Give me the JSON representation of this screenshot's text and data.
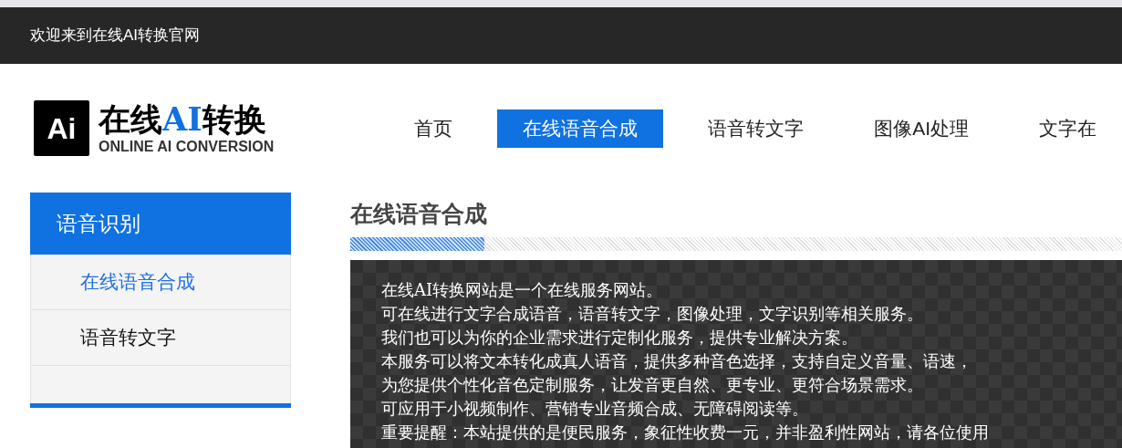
{
  "top_bar": {
    "welcome": "欢迎来到在线AI转换官网"
  },
  "logo": {
    "mark": "Ai",
    "title_segments": [
      {
        "text": "在线",
        "highlight": false
      },
      {
        "text": "AI",
        "highlight": true
      },
      {
        "text": "转换",
        "highlight": false
      }
    ],
    "subtitle": "ONLINE AI CONVERSION"
  },
  "nav": [
    {
      "label": "首页",
      "selected": false
    },
    {
      "label": "在线语音合成",
      "selected": true
    },
    {
      "label": "语音转文字",
      "selected": false
    },
    {
      "label": "图像AI处理",
      "selected": false
    },
    {
      "label": "文字在",
      "selected": false
    }
  ],
  "sidebar": {
    "title": "语音识别",
    "items": [
      {
        "label": "在线语音合成",
        "selected": true
      },
      {
        "label": "语音转文字",
        "selected": false
      }
    ]
  },
  "content": {
    "title": "在线语音合成",
    "lines": [
      "在线AI转换网站是一个在线服务网站。",
      "可在线进行文字合成语音，语音转文字，图像处理，文字识别等相关服务。",
      "我们也可以为你的企业需求进行定制化服务，提供专业解决方案。",
      "本服务可以将文本转化成真人语音，提供多种音色选择，支持自定义音量、语速，",
      "为您提供个性化音色定制服务，让发音更自然、更专业、更符合场景需求。",
      "可应用于小视频制作、营销专业音频合成、无障碍阅读等。",
      "重要提醒：本站提供的是便民服务，象征性收费一元，并非盈利性网站，请各位使用"
    ]
  }
}
